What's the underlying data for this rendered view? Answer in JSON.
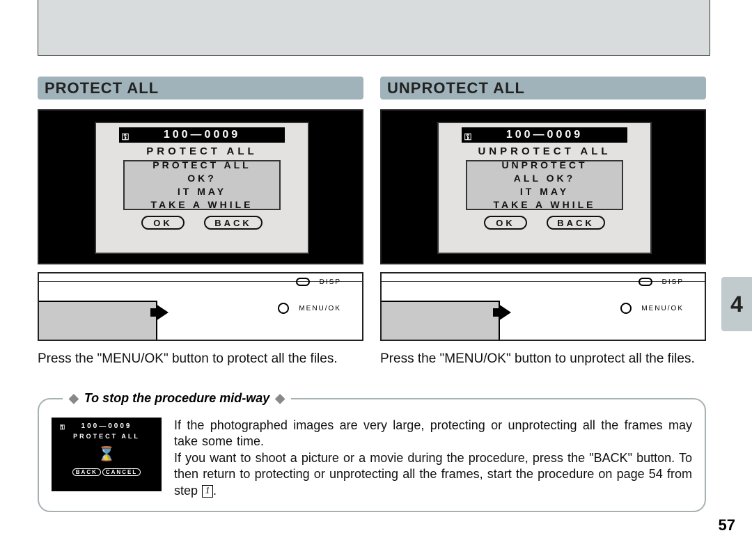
{
  "protect": {
    "header": "PROTECT ALL",
    "fileNumber": "100—0009",
    "screenTitle": "PROTECT ALL",
    "dialogLine1": "PROTECT ALL",
    "dialogLine2": "OK?",
    "dialogLine3": "IT MAY",
    "dialogLine4": "TAKE A WHILE",
    "okLabel": "OK",
    "backLabel": "BACK",
    "dispLabel": "DISP",
    "menuLabel": "MENU/OK",
    "instruction": "Press the \"MENU/OK\" button to protect all the files."
  },
  "unprotect": {
    "header": "UNPROTECT ALL",
    "fileNumber": "100—0009",
    "screenTitle": "UNPROTECT ALL",
    "dialogLine1": "UNPROTECT",
    "dialogLine2": "ALL OK?",
    "dialogLine3": "IT MAY",
    "dialogLine4": "TAKE A WHILE",
    "okLabel": "OK",
    "backLabel": "BACK",
    "dispLabel": "DISP",
    "menuLabel": "MENU/OK",
    "instruction": "Press the \"MENU/OK\" button to unprotect all the files."
  },
  "tip": {
    "title": "To stop the procedure mid-way",
    "miniFileNumber": "100—0009",
    "miniTitle": "PROTECT ALL",
    "miniBack": "BACK",
    "miniCancel": "CANCEL",
    "text1": "If the photographed images are very large, protecting or unprotecting all the frames may take some time.",
    "text2a": "If you want to shoot a picture or a movie during the procedure, press the \"BACK\" button. To then return to protecting or unprotecting all the frames, start the procedure on page 54 from step ",
    "stepNum": "1",
    "text2b": "."
  },
  "sideTab": "4",
  "pageNumber": "57"
}
